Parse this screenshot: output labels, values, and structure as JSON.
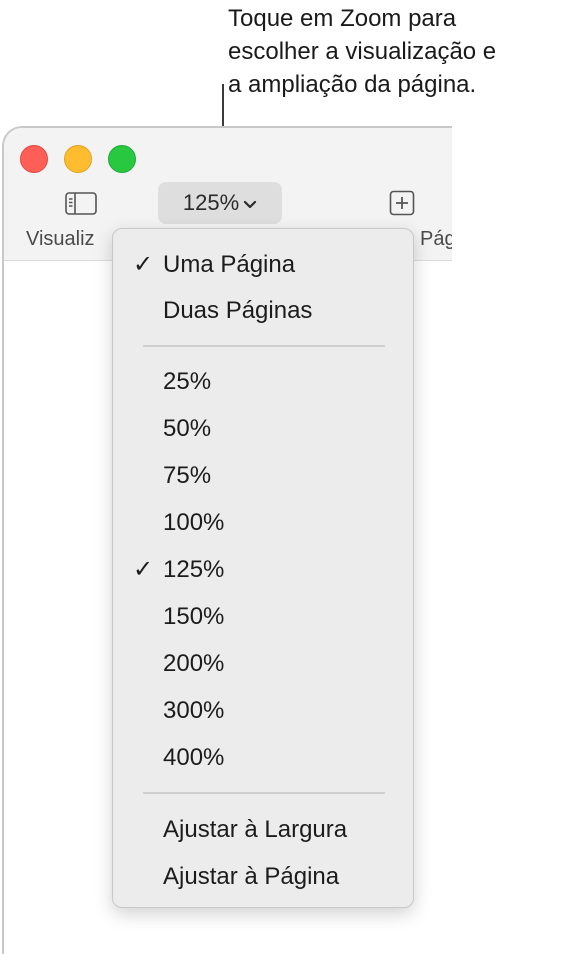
{
  "callout": {
    "lines": [
      "Toque em Zoom para",
      "escolher a visualização e",
      "a ampliação da página."
    ]
  },
  "toolbar": {
    "view_label": "Visualiz",
    "zoom_label": "125%",
    "add_label": "Pág"
  },
  "menu": {
    "page_items": [
      {
        "label": "Uma Página",
        "checked": true
      },
      {
        "label": "Duas Páginas",
        "checked": false
      }
    ],
    "zoom_items": [
      {
        "label": "25%",
        "checked": false
      },
      {
        "label": "50%",
        "checked": false
      },
      {
        "label": "75%",
        "checked": false
      },
      {
        "label": "100%",
        "checked": false
      },
      {
        "label": "125%",
        "checked": true
      },
      {
        "label": "150%",
        "checked": false
      },
      {
        "label": "200%",
        "checked": false
      },
      {
        "label": "300%",
        "checked": false
      },
      {
        "label": "400%",
        "checked": false
      }
    ],
    "fit_items": [
      {
        "label": "Ajustar à Largura",
        "checked": false
      },
      {
        "label": "Ajustar à Página",
        "checked": false
      }
    ],
    "check_glyph": "✓"
  },
  "colors": {
    "close": "#ff5f57",
    "minimize": "#febc2e",
    "maximize": "#28c840",
    "menu_bg": "#ececec"
  },
  "icons": {
    "view": "sidebar-icon",
    "zoom_chevron": "chevron-down-icon",
    "add": "plus-square-icon"
  }
}
